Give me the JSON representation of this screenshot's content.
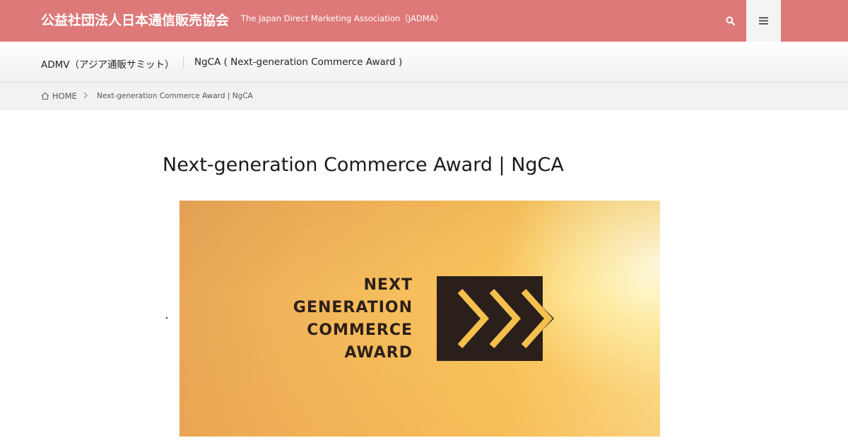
{
  "header": {
    "site_title": "公益社団法人日本通信販売協会",
    "site_subtitle": "The Japan Direct Marketing Association（JADMA）",
    "search_icon": "search-icon",
    "menu_icon": "hamburger-menu-icon",
    "background_color": "#de7979"
  },
  "nav": {
    "items": [
      {
        "label": "ADMV（アジア通販サミット）"
      },
      {
        "label": "NgCA ( Next-generation Commerce Award )"
      }
    ]
  },
  "breadcrumb": {
    "home_label": "HOME",
    "home_icon": "home-icon",
    "separator_icon": "chevron-right-icon",
    "current": "Next-generation Commerce Award | NgCA"
  },
  "main": {
    "title": "Next-generation Commerce Award | NgCA",
    "banner": {
      "lines": [
        "NEXT",
        "GENERATION",
        "COMMERCE",
        "AWARD"
      ],
      "mark_icon": "triple-chevron-arrow-icon",
      "colors": {
        "background": "#f7c05c",
        "mark": "#2a1f1a",
        "chevron": "#f6c04e"
      }
    }
  }
}
